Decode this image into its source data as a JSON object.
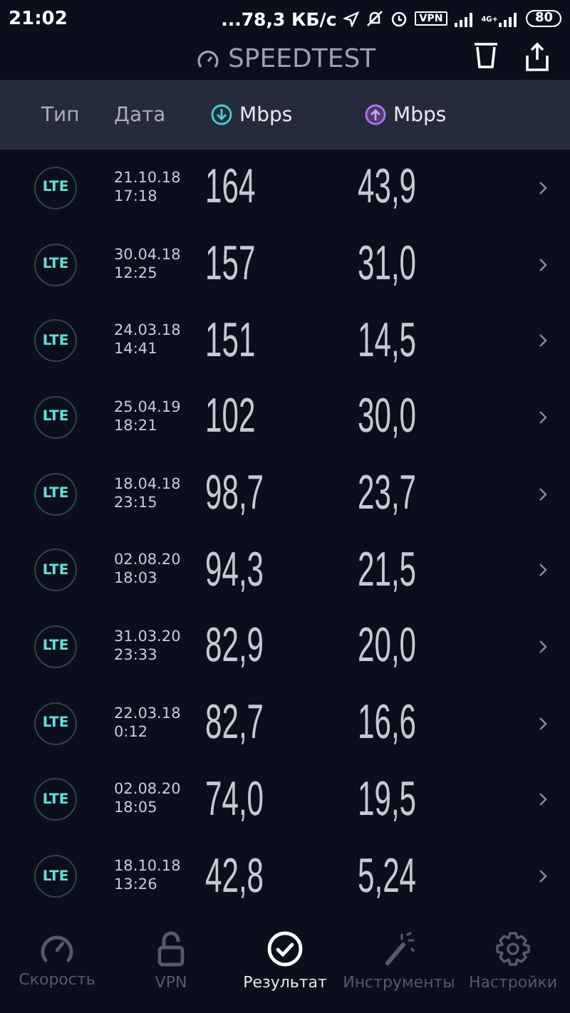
{
  "status_bar": {
    "time": "21:02",
    "speed": "...78,3 КБ/с",
    "vpn": "VPN",
    "network": "4G+",
    "battery": "80"
  },
  "header": {
    "title": "SPEEDTEST"
  },
  "columns": {
    "type": "Тип",
    "date": "Дата",
    "download": "Mbps",
    "upload": "Mbps"
  },
  "rows": [
    {
      "type": "LTE",
      "date": "21.10.18",
      "time": "17:18",
      "download": "164",
      "upload": "43,9"
    },
    {
      "type": "LTE",
      "date": "30.04.18",
      "time": "12:25",
      "download": "157",
      "upload": "31,0"
    },
    {
      "type": "LTE",
      "date": "24.03.18",
      "time": "14:41",
      "download": "151",
      "upload": "14,5"
    },
    {
      "type": "LTE",
      "date": "25.04.19",
      "time": "18:21",
      "download": "102",
      "upload": "30,0"
    },
    {
      "type": "LTE",
      "date": "18.04.18",
      "time": "23:15",
      "download": "98,7",
      "upload": "23,7"
    },
    {
      "type": "LTE",
      "date": "02.08.20",
      "time": "18:03",
      "download": "94,3",
      "upload": "21,5"
    },
    {
      "type": "LTE",
      "date": "31.03.20",
      "time": "23:33",
      "download": "82,9",
      "upload": "20,0"
    },
    {
      "type": "LTE",
      "date": "22.03.18",
      "time": "0:12",
      "download": "82,7",
      "upload": "16,6"
    },
    {
      "type": "LTE",
      "date": "02.08.20",
      "time": "18:05",
      "download": "74,0",
      "upload": "19,5"
    },
    {
      "type": "LTE",
      "date": "18.10.18",
      "time": "13:26",
      "download": "42,8",
      "upload": "5,24"
    }
  ],
  "nav": [
    {
      "kind": "speed",
      "label": "Скорость",
      "selected": false
    },
    {
      "kind": "vpn",
      "label": "VPN",
      "selected": false
    },
    {
      "kind": "results",
      "label": "Результат",
      "selected": true
    },
    {
      "kind": "tools",
      "label": "Инструменты",
      "selected": false
    },
    {
      "kind": "settings",
      "label": "Настройки",
      "selected": false
    }
  ]
}
